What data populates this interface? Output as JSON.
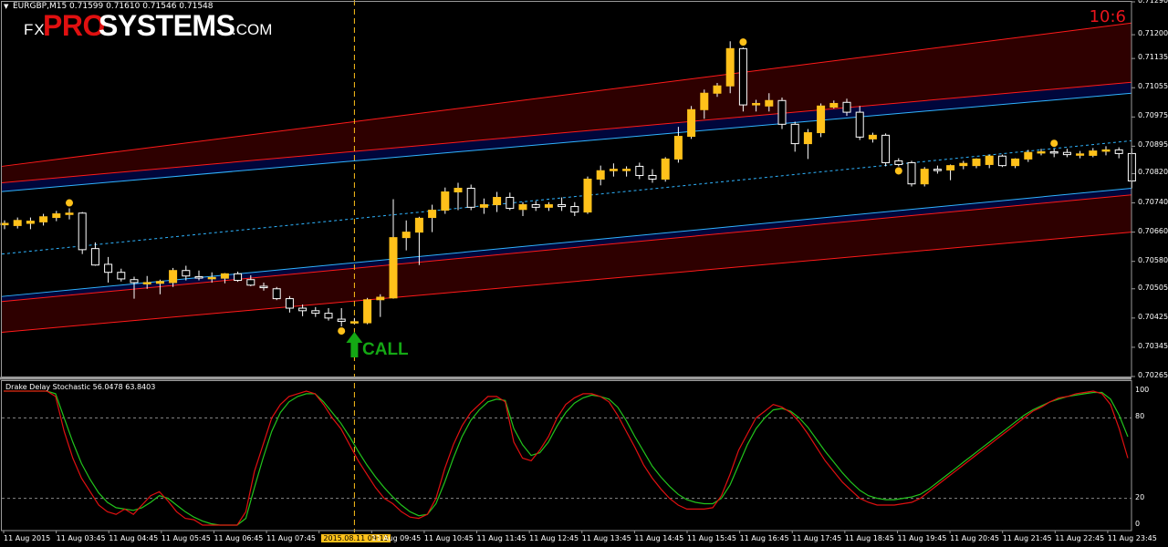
{
  "header": {
    "symbol": "EURGBP,M15  0.71599 0.71610 0.71546 0.71548",
    "timer": "10:6"
  },
  "logo": {
    "fx": "FX",
    "pro": "PRO",
    "systems": "SYSTEMS",
    "com": ".COM"
  },
  "signal_label": "CALL",
  "indicator": {
    "label": "Drake Delay Stochastic 56.0478 63.8403"
  },
  "colors": {
    "bull_candle": "#ffc11a",
    "bear_candle": "#ffffff",
    "band_outer": "#ff1a1a",
    "band_inner": "#2fb4ff",
    "band_fill_outer": "#2e0000",
    "band_fill_inner": "#00063b",
    "stoch_main": "#22c41c",
    "stoch_signal": "#e01010",
    "call_arrow": "#14a814",
    "marker": "#ffc11a"
  },
  "chart_data": [
    {
      "type": "candlestick",
      "title": "EURGBP,M15",
      "ylim": [
        0.70265,
        0.7129
      ],
      "y_ticks": [
        "0.71290",
        "0.71200",
        "0.71135",
        "0.71055",
        "0.70975",
        "0.70895",
        "0.70820",
        "0.70740",
        "0.70660",
        "0.70580",
        "0.70505",
        "0.70425",
        "0.70345",
        "0.70265"
      ],
      "x_labels": [
        "11 Aug 2015",
        "11 Aug 03:45",
        "11 Aug 04:45",
        "11 Aug 05:45",
        "11 Aug 06:45",
        "11 Aug 07:45",
        "2015.08.11 09:15",
        "11 Aug 09:45",
        "11 Aug 10:45",
        "11 Aug 11:45",
        "11 Aug 12:45",
        "11 Aug 13:45",
        "11 Aug 14:45",
        "11 Aug 15:45",
        "11 Aug 16:45",
        "11 Aug 17:45",
        "11 Aug 18:45",
        "11 Aug 19:45",
        "11 Aug 20:45",
        "11 Aug 21:45",
        "11 Aug 22:45",
        "11 Aug 23:45"
      ],
      "selected_x_label": "2015.08.11 09:15",
      "candles": [
        {
          "o": 0.7068,
          "h": 0.70692,
          "l": 0.70668,
          "c": 0.70684
        },
        {
          "o": 0.70678,
          "h": 0.707,
          "l": 0.7067,
          "c": 0.70692
        },
        {
          "o": 0.70684,
          "h": 0.707,
          "l": 0.70668,
          "c": 0.7069
        },
        {
          "o": 0.70688,
          "h": 0.7071,
          "l": 0.70678,
          "c": 0.70702
        },
        {
          "o": 0.707,
          "h": 0.70718,
          "l": 0.7069,
          "c": 0.7071
        },
        {
          "o": 0.7071,
          "h": 0.70725,
          "l": 0.70695,
          "c": 0.70712
        },
        {
          "o": 0.70712,
          "h": 0.70715,
          "l": 0.706,
          "c": 0.70612
        },
        {
          "o": 0.70615,
          "h": 0.70632,
          "l": 0.70568,
          "c": 0.7057
        },
        {
          "o": 0.70572,
          "h": 0.70592,
          "l": 0.70522,
          "c": 0.7055
        },
        {
          "o": 0.7055,
          "h": 0.7056,
          "l": 0.70525,
          "c": 0.70532
        },
        {
          "o": 0.7053,
          "h": 0.70538,
          "l": 0.70478,
          "c": 0.70522
        },
        {
          "o": 0.7052,
          "h": 0.7054,
          "l": 0.70505,
          "c": 0.70522
        },
        {
          "o": 0.7052,
          "h": 0.7053,
          "l": 0.7049,
          "c": 0.70525
        },
        {
          "o": 0.70522,
          "h": 0.70562,
          "l": 0.7051,
          "c": 0.70555
        },
        {
          "o": 0.70555,
          "h": 0.70568,
          "l": 0.70528,
          "c": 0.7054
        },
        {
          "o": 0.70538,
          "h": 0.70555,
          "l": 0.70528,
          "c": 0.70536
        },
        {
          "o": 0.70536,
          "h": 0.7055,
          "l": 0.70522,
          "c": 0.70536
        },
        {
          "o": 0.70534,
          "h": 0.70548,
          "l": 0.7052,
          "c": 0.70546
        },
        {
          "o": 0.70546,
          "h": 0.70552,
          "l": 0.70524,
          "c": 0.70528
        },
        {
          "o": 0.7053,
          "h": 0.70542,
          "l": 0.70512,
          "c": 0.70515
        },
        {
          "o": 0.70512,
          "h": 0.70522,
          "l": 0.705,
          "c": 0.70508
        },
        {
          "o": 0.70505,
          "h": 0.7051,
          "l": 0.70474,
          "c": 0.70478
        },
        {
          "o": 0.70478,
          "h": 0.70485,
          "l": 0.7044,
          "c": 0.70452
        },
        {
          "o": 0.70452,
          "h": 0.70462,
          "l": 0.7043,
          "c": 0.70445
        },
        {
          "o": 0.70445,
          "h": 0.70455,
          "l": 0.70428,
          "c": 0.70438
        },
        {
          "o": 0.70438,
          "h": 0.70452,
          "l": 0.70418,
          "c": 0.70425
        },
        {
          "o": 0.70422,
          "h": 0.70452,
          "l": 0.70402,
          "c": 0.70416
        },
        {
          "o": 0.70415,
          "h": 0.70425,
          "l": 0.70408,
          "c": 0.70415
        },
        {
          "o": 0.70412,
          "h": 0.7048,
          "l": 0.70408,
          "c": 0.70475
        },
        {
          "o": 0.70475,
          "h": 0.7049,
          "l": 0.70428,
          "c": 0.70482
        },
        {
          "o": 0.7048,
          "h": 0.7075,
          "l": 0.70478,
          "c": 0.70645
        },
        {
          "o": 0.70645,
          "h": 0.70692,
          "l": 0.7061,
          "c": 0.7066
        },
        {
          "o": 0.7066,
          "h": 0.70702,
          "l": 0.7057,
          "c": 0.70698
        },
        {
          "o": 0.707,
          "h": 0.70735,
          "l": 0.7066,
          "c": 0.7072
        },
        {
          "o": 0.7072,
          "h": 0.70782,
          "l": 0.7071,
          "c": 0.7077
        },
        {
          "o": 0.7077,
          "h": 0.70795,
          "l": 0.7072,
          "c": 0.7078
        },
        {
          "o": 0.7078,
          "h": 0.7079,
          "l": 0.7072,
          "c": 0.70728
        },
        {
          "o": 0.70728,
          "h": 0.70752,
          "l": 0.7071,
          "c": 0.70735
        },
        {
          "o": 0.70735,
          "h": 0.7077,
          "l": 0.70715,
          "c": 0.70755
        },
        {
          "o": 0.70755,
          "h": 0.70768,
          "l": 0.7072,
          "c": 0.70725
        },
        {
          "o": 0.70722,
          "h": 0.70742,
          "l": 0.70704,
          "c": 0.70735
        },
        {
          "o": 0.70735,
          "h": 0.70745,
          "l": 0.70718,
          "c": 0.70728
        },
        {
          "o": 0.70728,
          "h": 0.70742,
          "l": 0.70718,
          "c": 0.70735
        },
        {
          "o": 0.70735,
          "h": 0.70755,
          "l": 0.70718,
          "c": 0.7073
        },
        {
          "o": 0.7073,
          "h": 0.70742,
          "l": 0.70704,
          "c": 0.70715
        },
        {
          "o": 0.70715,
          "h": 0.70812,
          "l": 0.7071,
          "c": 0.70805
        },
        {
          "o": 0.70805,
          "h": 0.70842,
          "l": 0.70788,
          "c": 0.70828
        },
        {
          "o": 0.70828,
          "h": 0.70848,
          "l": 0.70812,
          "c": 0.70832
        },
        {
          "o": 0.70832,
          "h": 0.7084,
          "l": 0.70812,
          "c": 0.70832
        },
        {
          "o": 0.7084,
          "h": 0.7085,
          "l": 0.70805,
          "c": 0.70815
        },
        {
          "o": 0.70815,
          "h": 0.70832,
          "l": 0.70795,
          "c": 0.70805
        },
        {
          "o": 0.70805,
          "h": 0.70865,
          "l": 0.70798,
          "c": 0.7086
        },
        {
          "o": 0.7086,
          "h": 0.70948,
          "l": 0.7085,
          "c": 0.70922
        },
        {
          "o": 0.70922,
          "h": 0.71005,
          "l": 0.70915,
          "c": 0.70995
        },
        {
          "o": 0.70995,
          "h": 0.7105,
          "l": 0.7097,
          "c": 0.7104
        },
        {
          "o": 0.7104,
          "h": 0.71068,
          "l": 0.7103,
          "c": 0.7106
        },
        {
          "o": 0.7106,
          "h": 0.71182,
          "l": 0.7104,
          "c": 0.71162
        },
        {
          "o": 0.71162,
          "h": 0.71165,
          "l": 0.7099,
          "c": 0.71008
        },
        {
          "o": 0.71008,
          "h": 0.71022,
          "l": 0.7099,
          "c": 0.71012
        },
        {
          "o": 0.71005,
          "h": 0.7104,
          "l": 0.7099,
          "c": 0.7102
        },
        {
          "o": 0.7102,
          "h": 0.71028,
          "l": 0.70942,
          "c": 0.70955
        },
        {
          "o": 0.70955,
          "h": 0.70962,
          "l": 0.7088,
          "c": 0.70902
        },
        {
          "o": 0.70902,
          "h": 0.70942,
          "l": 0.7086,
          "c": 0.70932
        },
        {
          "o": 0.70932,
          "h": 0.71012,
          "l": 0.7092,
          "c": 0.71005
        },
        {
          "o": 0.71002,
          "h": 0.7102,
          "l": 0.70998,
          "c": 0.71012
        },
        {
          "o": 0.71015,
          "h": 0.71025,
          "l": 0.70978,
          "c": 0.70988
        },
        {
          "o": 0.70988,
          "h": 0.71005,
          "l": 0.70912,
          "c": 0.7092
        },
        {
          "o": 0.70915,
          "h": 0.70932,
          "l": 0.70905,
          "c": 0.70925
        },
        {
          "o": 0.70925,
          "h": 0.7093,
          "l": 0.7084,
          "c": 0.7085
        },
        {
          "o": 0.70855,
          "h": 0.70862,
          "l": 0.7084,
          "c": 0.70845
        },
        {
          "o": 0.7085,
          "h": 0.70855,
          "l": 0.70785,
          "c": 0.70792
        },
        {
          "o": 0.70792,
          "h": 0.70838,
          "l": 0.70785,
          "c": 0.70832
        },
        {
          "o": 0.70832,
          "h": 0.70842,
          "l": 0.7082,
          "c": 0.7083
        },
        {
          "o": 0.7083,
          "h": 0.70845,
          "l": 0.70802,
          "c": 0.70842
        },
        {
          "o": 0.70842,
          "h": 0.70855,
          "l": 0.70832,
          "c": 0.70848
        },
        {
          "o": 0.70842,
          "h": 0.70862,
          "l": 0.70835,
          "c": 0.7086
        },
        {
          "o": 0.70845,
          "h": 0.70872,
          "l": 0.70835,
          "c": 0.70868
        },
        {
          "o": 0.70868,
          "h": 0.70872,
          "l": 0.70838,
          "c": 0.70842
        },
        {
          "o": 0.70842,
          "h": 0.70862,
          "l": 0.70835,
          "c": 0.7086
        },
        {
          "o": 0.7086,
          "h": 0.70885,
          "l": 0.70852,
          "c": 0.70878
        },
        {
          "o": 0.70878,
          "h": 0.70888,
          "l": 0.7087,
          "c": 0.7088
        },
        {
          "o": 0.7088,
          "h": 0.70888,
          "l": 0.70865,
          "c": 0.70878
        },
        {
          "o": 0.70878,
          "h": 0.70888,
          "l": 0.70865,
          "c": 0.70872
        },
        {
          "o": 0.70872,
          "h": 0.70882,
          "l": 0.70862,
          "c": 0.70874
        },
        {
          "o": 0.7087,
          "h": 0.7089,
          "l": 0.70865,
          "c": 0.70882
        },
        {
          "o": 0.70882,
          "h": 0.70895,
          "l": 0.7087,
          "c": 0.70885
        },
        {
          "o": 0.70885,
          "h": 0.70892,
          "l": 0.70862,
          "c": 0.70875
        },
        {
          "o": 0.70875,
          "h": 0.7089,
          "l": 0.7078,
          "c": 0.708
        }
      ],
      "top_markers": [
        5,
        57,
        81
      ],
      "bottom_markers": [
        26,
        69
      ],
      "signal_candle": 27,
      "bands": {
        "outer_upper": [
          0.7084,
          0.71232
        ],
        "inner_upper": [
          0.70795,
          0.7107
        ],
        "middle": [
          0.706,
          0.7091
        ],
        "inner_lower": [
          0.70484,
          0.7078
        ],
        "outer_lower": [
          0.70386,
          0.7066
        ]
      }
    },
    {
      "type": "line",
      "title": "Drake Delay Stochastic",
      "ylim": [
        0,
        100
      ],
      "y_ticks": [
        0,
        20,
        80,
        100
      ],
      "levels": [
        20,
        80
      ],
      "series": [
        {
          "values": [
            100,
            100,
            100,
            100,
            100,
            100,
            96,
            70,
            50,
            35,
            25,
            15,
            10,
            8,
            12,
            8,
            15,
            22,
            25,
            18,
            10,
            5,
            4,
            0,
            0,
            0,
            0,
            0,
            10,
            40,
            60,
            80,
            90,
            96,
            98,
            100,
            98,
            90,
            80,
            72,
            60,
            48,
            38,
            28,
            20,
            16,
            10,
            6,
            5,
            8,
            20,
            42,
            60,
            74,
            84,
            90,
            96,
            96,
            92,
            62,
            50,
            48,
            56,
            66,
            80,
            90,
            95,
            98,
            98,
            96,
            92,
            82,
            70,
            58,
            45,
            35,
            27,
            20,
            15,
            12,
            12,
            12,
            13,
            22,
            38,
            56,
            68,
            80,
            85,
            90,
            88,
            84,
            77,
            68,
            58,
            48,
            40,
            32,
            26,
            20,
            17,
            15,
            15,
            15,
            16,
            17,
            20,
            25,
            30,
            35,
            40,
            45,
            50,
            55,
            60,
            65,
            70,
            75,
            80,
            85,
            88,
            92,
            95,
            96,
            98,
            99,
            100,
            98,
            90,
            72,
            50
          ]
        },
        {
          "values": [
            100,
            100,
            100,
            100,
            100,
            100,
            98,
            80,
            62,
            46,
            34,
            24,
            17,
            13,
            12,
            11,
            13,
            17,
            22,
            20,
            15,
            10,
            6,
            3,
            1,
            0,
            0,
            0,
            5,
            28,
            50,
            70,
            84,
            92,
            96,
            98,
            98,
            92,
            84,
            76,
            66,
            55,
            45,
            36,
            28,
            21,
            15,
            10,
            7,
            8,
            16,
            32,
            50,
            66,
            78,
            86,
            92,
            94,
            93,
            72,
            60,
            52,
            54,
            62,
            74,
            84,
            91,
            95,
            97,
            96,
            94,
            88,
            78,
            66,
            55,
            44,
            36,
            29,
            23,
            19,
            17,
            16,
            16,
            20,
            30,
            45,
            60,
            72,
            80,
            86,
            87,
            85,
            80,
            73,
            64,
            55,
            47,
            39,
            32,
            26,
            22,
            20,
            19,
            19,
            20,
            21,
            23,
            27,
            32,
            37,
            42,
            47,
            52,
            57,
            62,
            67,
            72,
            77,
            82,
            86,
            89,
            92,
            94,
            96,
            97,
            98,
            99,
            99,
            94,
            82,
            66
          ]
        }
      ]
    }
  ]
}
